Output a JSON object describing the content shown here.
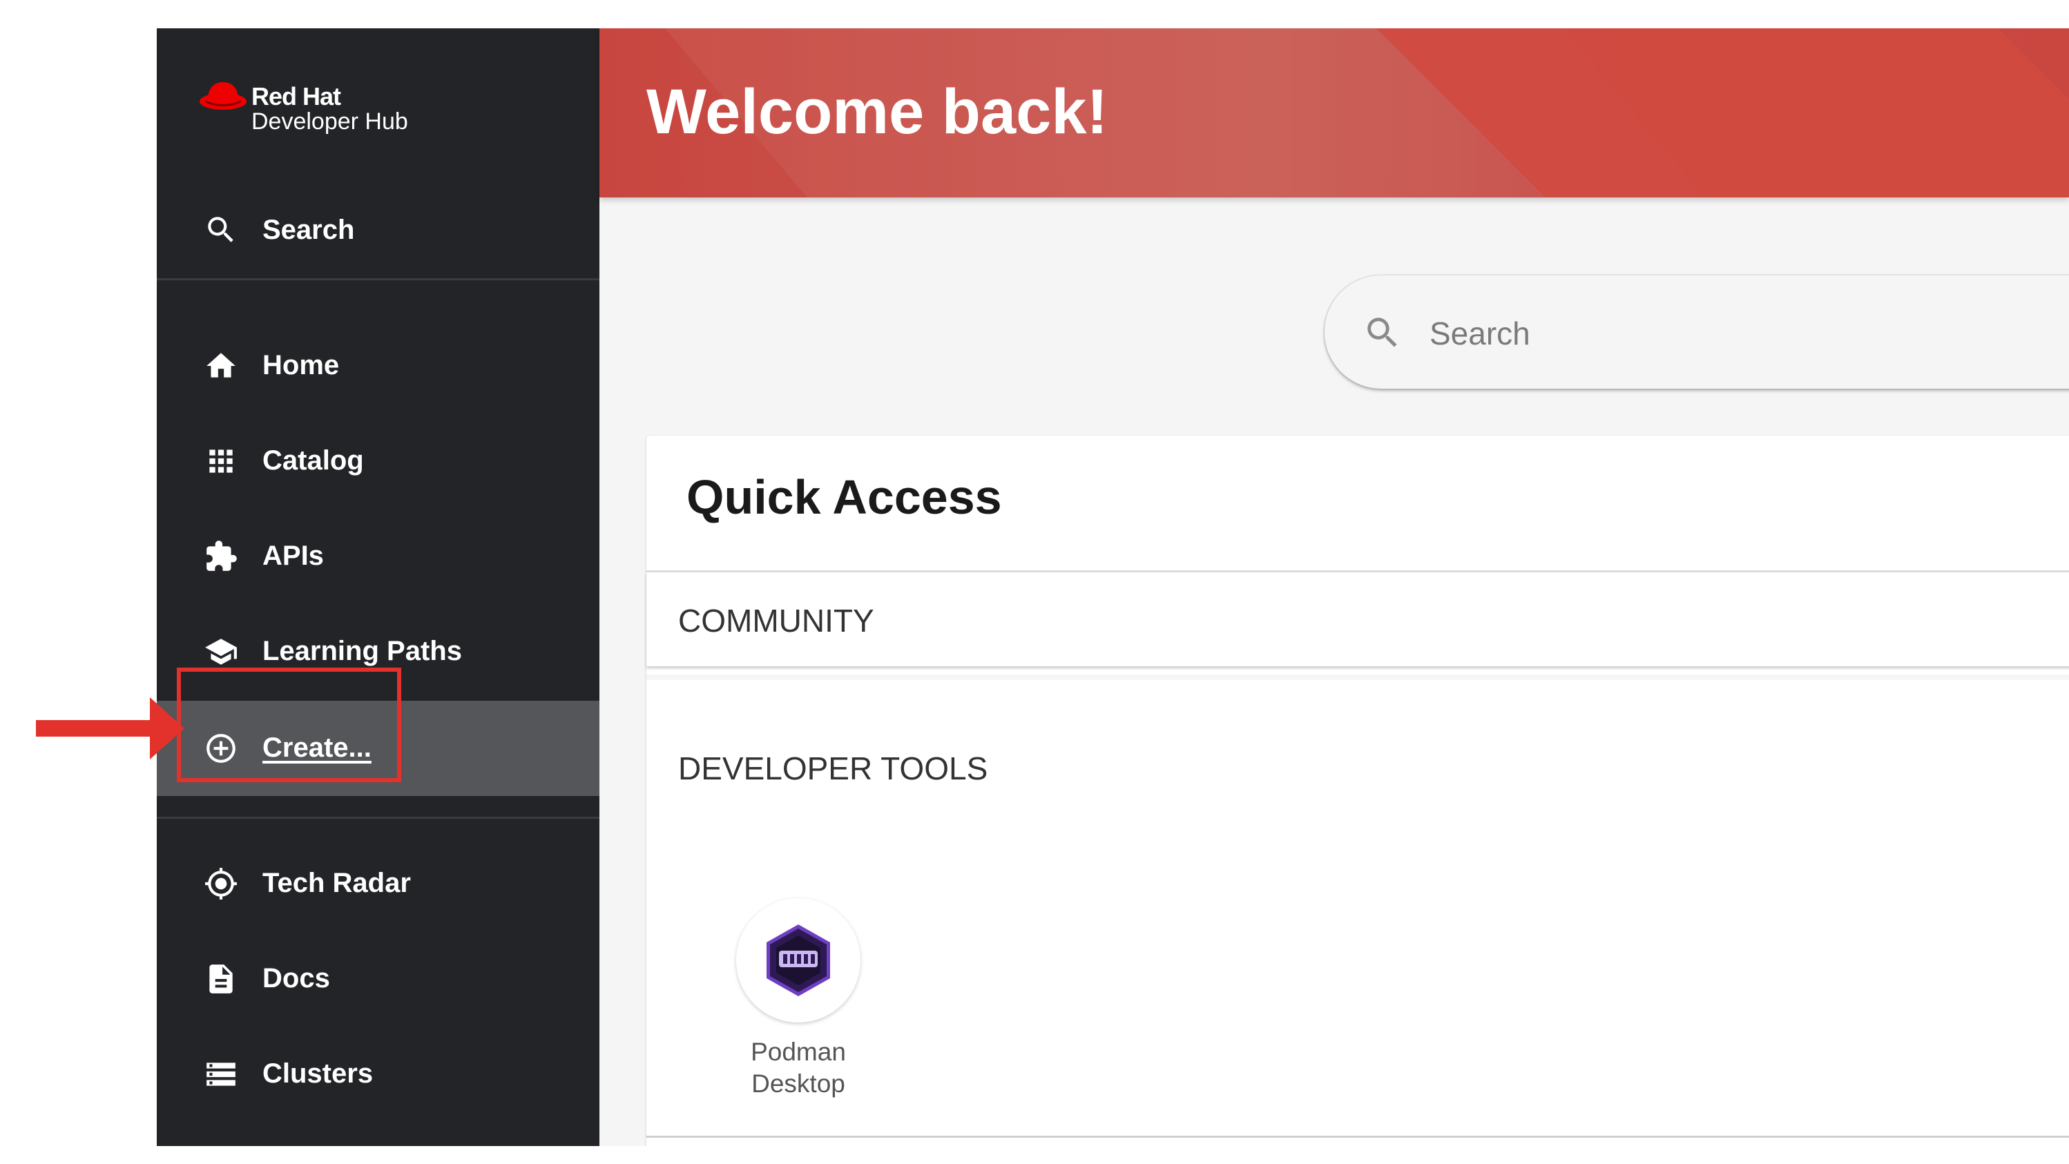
{
  "sidebar": {
    "logo": {
      "brand": "Red Hat",
      "product": "Developer Hub"
    },
    "search_label": "Search",
    "items": [
      {
        "label": "Home",
        "icon": "home-icon"
      },
      {
        "label": "Catalog",
        "icon": "grid-icon"
      },
      {
        "label": "APIs",
        "icon": "puzzle-icon"
      },
      {
        "label": "Learning Paths",
        "icon": "school-icon"
      },
      {
        "label": "Create...",
        "icon": "add-circle-icon",
        "active": true
      },
      {
        "label": "Tech Radar",
        "icon": "radar-icon"
      },
      {
        "label": "Docs",
        "icon": "document-icon"
      },
      {
        "label": "Clusters",
        "icon": "storage-icon"
      }
    ]
  },
  "header": {
    "title": "Welcome back!"
  },
  "search": {
    "placeholder": "Search"
  },
  "quick_access": {
    "title": "Quick Access",
    "sections": [
      {
        "label": "COMMUNITY"
      },
      {
        "label": "DEVELOPER TOOLS",
        "tools": [
          {
            "label": "Podman Desktop",
            "icon": "podman-icon"
          }
        ]
      }
    ]
  },
  "annotation": {
    "color": "#e3322b"
  },
  "colors": {
    "sidebar_bg": "#232427",
    "active_item_bg": "#55565a",
    "banner_red": "#c8463f",
    "highlight": "#e3322b"
  }
}
